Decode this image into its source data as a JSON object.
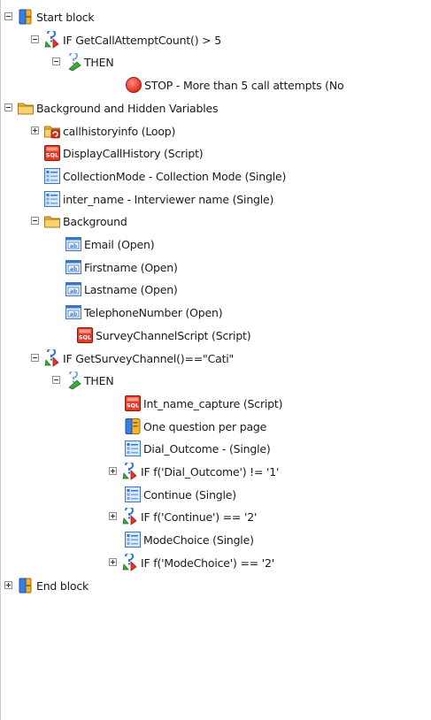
{
  "tree": {
    "nodes": [
      {
        "label": "Start block",
        "type": "block",
        "depth": 0,
        "expander": "minus"
      },
      {
        "label": "IF GetCallAttemptCount() > 5",
        "type": "if",
        "depth": 1,
        "expander": "minus"
      },
      {
        "label": "THEN",
        "type": "then",
        "depth": 2,
        "expander": "minus"
      },
      {
        "label": "STOP - More than 5 call attempts (No",
        "type": "stop",
        "depth": 3,
        "expander": "none"
      },
      {
        "label": "Background and Hidden Variables",
        "type": "folder",
        "depth": 0,
        "expander": "minus"
      },
      {
        "label": "callhistoryinfo (Loop)",
        "type": "loop",
        "depth": 1,
        "expander": "plus"
      },
      {
        "label": "DisplayCallHistory (Script)",
        "type": "script",
        "depth": 1,
        "expander": "none"
      },
      {
        "label": "CollectionMode - Collection Mode (Single)",
        "type": "single",
        "depth": 1,
        "expander": "none"
      },
      {
        "label": "inter_name - Interviewer name (Single)",
        "type": "single",
        "depth": 1,
        "expander": "none"
      },
      {
        "label": "Background",
        "type": "folder",
        "depth": 1,
        "expander": "minus"
      },
      {
        "label": "Email (Open)",
        "type": "open",
        "depth": 2,
        "expander": "none"
      },
      {
        "label": "Firstname (Open)",
        "type": "open",
        "depth": 2,
        "expander": "none"
      },
      {
        "label": "Lastname (Open)",
        "type": "open",
        "depth": 2,
        "expander": "none"
      },
      {
        "label": "TelephoneNumber (Open)",
        "type": "open",
        "depth": 2,
        "expander": "none"
      },
      {
        "label": "SurveyChannelScript (Script)",
        "type": "script",
        "depth": 0,
        "expander": "none"
      },
      {
        "label": "IF GetSurveyChannel()==\"Cati\"",
        "type": "if",
        "depth": 1,
        "expander": "minus"
      },
      {
        "label": "THEN",
        "type": "then",
        "depth": 2,
        "expander": "minus"
      },
      {
        "label": "Int_name_capture (Script)",
        "type": "script",
        "depth": 3,
        "expander": "none"
      },
      {
        "label": "One question per page",
        "type": "page",
        "depth": 3,
        "expander": "none"
      },
      {
        "label": "Dial_Outcome - (Single)",
        "type": "single",
        "depth": 3,
        "expander": "none"
      },
      {
        "label": "IF f('Dial_Outcome') != '1'",
        "type": "if",
        "depth": 3,
        "expander": "plus"
      },
      {
        "label": "Continue (Single)",
        "type": "single",
        "depth": 3,
        "expander": "none"
      },
      {
        "label": "IF f('Continue') == '2'",
        "type": "if",
        "depth": 3,
        "expander": "plus"
      },
      {
        "label": "ModeChoice (Single)",
        "type": "single",
        "depth": 3,
        "expander": "none"
      },
      {
        "label": "IF f('ModeChoice') == '2'",
        "type": "if",
        "depth": 3,
        "expander": "plus"
      },
      {
        "label": "End block",
        "type": "block",
        "depth": 0,
        "expander": "plus"
      }
    ]
  }
}
